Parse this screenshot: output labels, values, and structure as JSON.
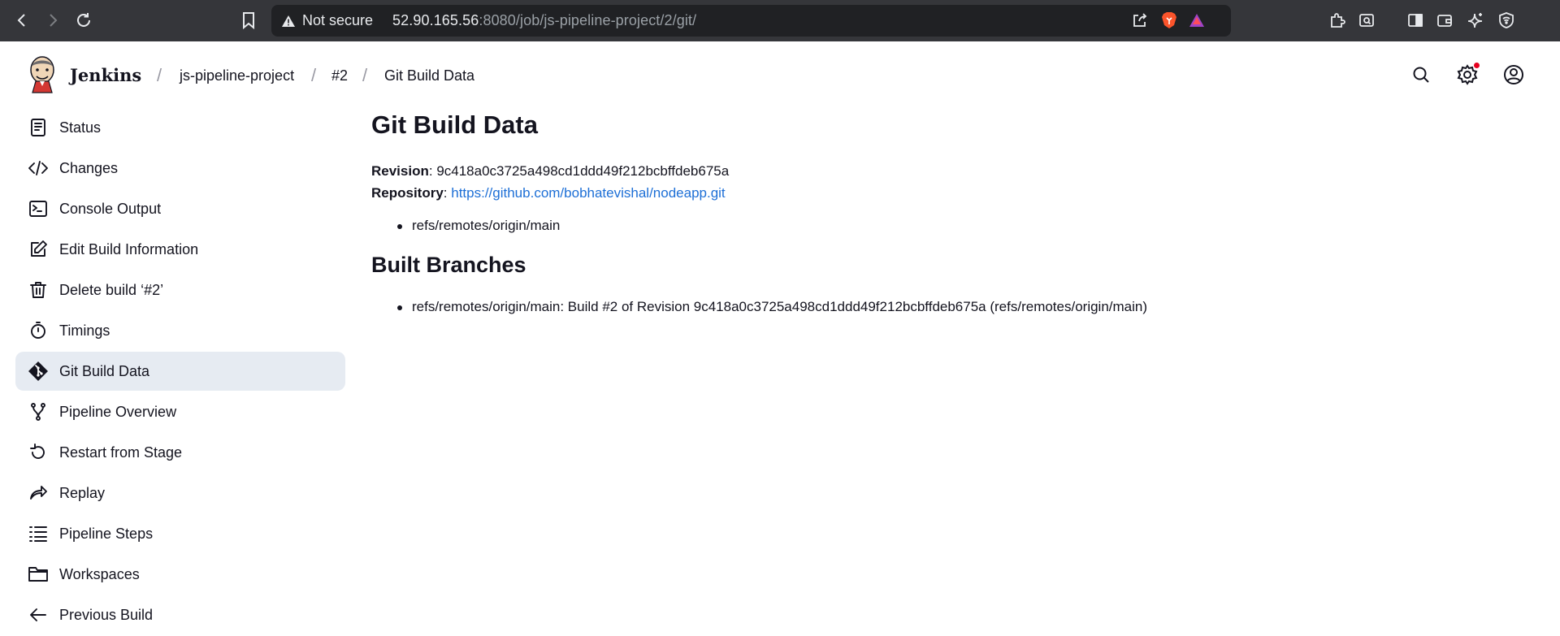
{
  "browser": {
    "not_secure_label": "Not secure",
    "url_host": "52.90.165.56",
    "url_rest": ":8080/job/js-pipeline-project/2/git/"
  },
  "header": {
    "brand": "Jenkins",
    "breadcrumbs": [
      "js-pipeline-project",
      "#2",
      "Git Build Data"
    ]
  },
  "sidebar": {
    "items": [
      {
        "label": "Status",
        "icon": "status-icon"
      },
      {
        "label": "Changes",
        "icon": "code-icon"
      },
      {
        "label": "Console Output",
        "icon": "terminal-icon"
      },
      {
        "label": "Edit Build Information",
        "icon": "edit-icon"
      },
      {
        "label": "Delete build ‘#2’",
        "icon": "trash-icon"
      },
      {
        "label": "Timings",
        "icon": "timer-icon"
      },
      {
        "label": "Git Build Data",
        "icon": "git-icon",
        "active": true
      },
      {
        "label": "Pipeline Overview",
        "icon": "branch-icon"
      },
      {
        "label": "Restart from Stage",
        "icon": "restart-icon"
      },
      {
        "label": "Replay",
        "icon": "replay-icon"
      },
      {
        "label": "Pipeline Steps",
        "icon": "steps-icon"
      },
      {
        "label": "Workspaces",
        "icon": "folder-icon"
      },
      {
        "label": "Previous Build",
        "icon": "arrow-left-icon"
      }
    ]
  },
  "main": {
    "title": "Git Build Data",
    "revision_label": "Revision",
    "revision_value": "9c418a0c3725a498cd1ddd49f212bcbffdeb675a",
    "repository_label": "Repository",
    "repository_url": "https://github.com/bobhatevishal/nodeapp.git",
    "refs": [
      "refs/remotes/origin/main"
    ],
    "built_branches_title": "Built Branches",
    "built_branches": [
      "refs/remotes/origin/main: Build #2 of Revision 9c418a0c3725a498cd1ddd49f212bcbffdeb675a (refs/remotes/origin/main)"
    ]
  },
  "colors": {
    "chrome_bg": "#35363a",
    "urlbar_bg": "#202124",
    "link": "#1d6fd6",
    "active_item_bg": "#e6ebf2",
    "notification_dot": "#e6001f"
  }
}
